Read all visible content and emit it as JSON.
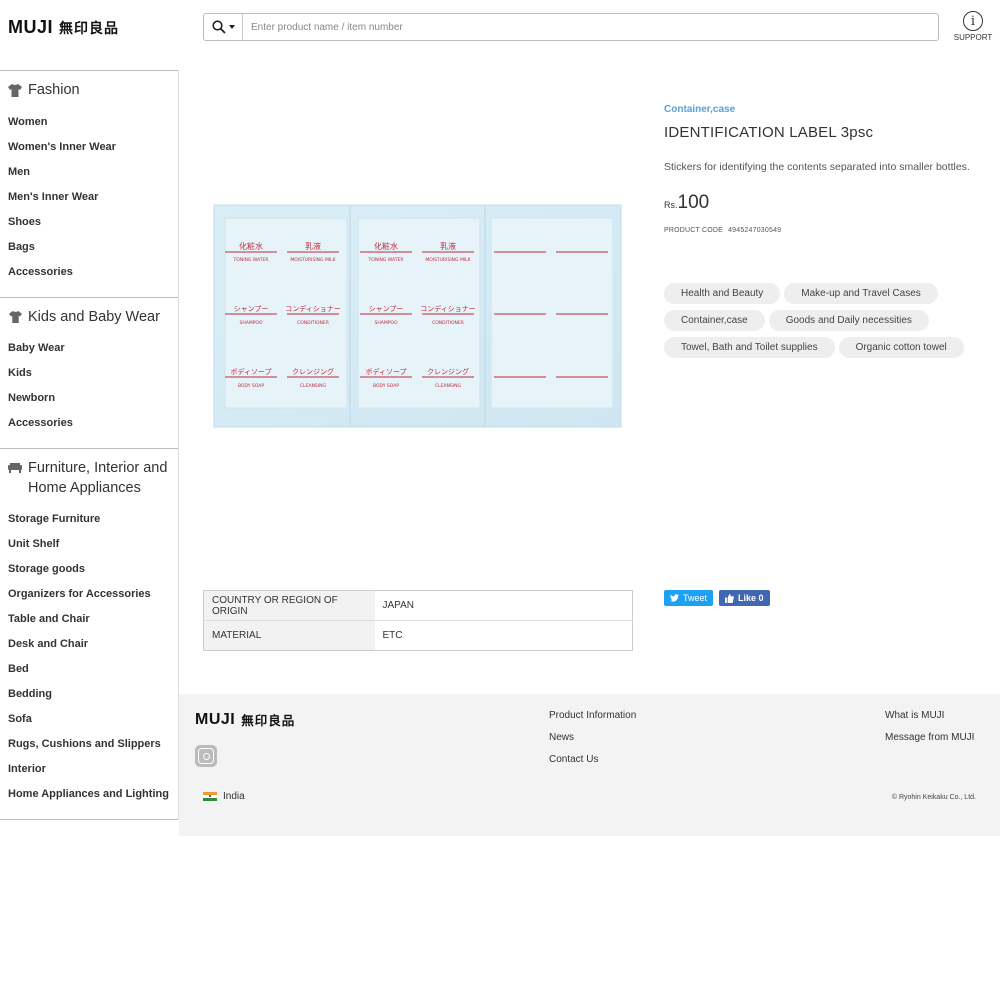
{
  "header": {
    "logo_latin": "MUJI",
    "logo_jp": "無印良品",
    "search_placeholder": "Enter product name / item number",
    "support_label": "SUPPORT",
    "support_glyph": "i"
  },
  "sidebar": {
    "sections": [
      {
        "title": "Fashion",
        "icon": "shirt-icon",
        "items": [
          "Women",
          "Women's Inner Wear",
          "Men",
          "Men's Inner Wear",
          "Shoes",
          "Bags",
          "Accessories"
        ]
      },
      {
        "title": "Kids and Baby Wear",
        "icon": "kids-shirt-icon",
        "items": [
          "Baby Wear",
          "Kids",
          "Newborn",
          "Accessories"
        ]
      },
      {
        "title": "Furniture, Interior and Home Appliances",
        "icon": "sofa-icon",
        "items": [
          "Storage Furniture",
          "Unit Shelf",
          "Storage goods",
          "Organizers for Accessories",
          "Table and Chair",
          "Desk and Chair",
          "Bed",
          "Bedding",
          "Sofa",
          "Rugs, Cushions and Slippers",
          "Interior",
          "Home Appliances and Lighting"
        ]
      }
    ]
  },
  "product": {
    "category": "Container,case",
    "title": "IDENTIFICATION LABEL 3psc",
    "description": "Stickers for identifying the contents separated into smaller bottles.",
    "currency": "Rs.",
    "price": "100",
    "code_label": "PRODUCT CODE",
    "code": "4945247030549",
    "tags": [
      "Health and Beauty",
      "Make-up and Travel Cases",
      "Container,case",
      "Goods and Daily necessities",
      "Towel, Bath and Toilet supplies",
      "Organic cotton towel"
    ],
    "image": {
      "labels_jp": [
        "化粧水",
        "乳液",
        "シャンプー",
        "コンディショナー",
        "ボディソープ",
        "クレンジング"
      ],
      "labels_en": [
        "TONING WATER",
        "MOISTURISING MILK",
        "SHAMPOO",
        "CONDITIONER",
        "BODY SOAP",
        "CLEANSING"
      ]
    },
    "specs": [
      {
        "key": "COUNTRY OR REGION OF ORIGIN",
        "value": "JAPAN"
      },
      {
        "key": "MATERIAL",
        "value": "ETC"
      }
    ]
  },
  "social": {
    "tweet_label": "Tweet",
    "like_label": "Like 0"
  },
  "footer": {
    "logo_latin": "MUJI",
    "logo_jp": "無印良品",
    "col1": [
      "Product Information",
      "News",
      "Contact Us"
    ],
    "col2": [
      "What is MUJI",
      "Message from MUJI"
    ],
    "region": "India",
    "copyright": "© Ryohin Keikaku Co., Ltd."
  },
  "colors": {
    "accent_link": "#5a9fd6",
    "label_red": "#c0283a",
    "sticker_blue": "#d6ecf5",
    "tweet": "#1da1f2",
    "facebook": "#4267b2"
  }
}
